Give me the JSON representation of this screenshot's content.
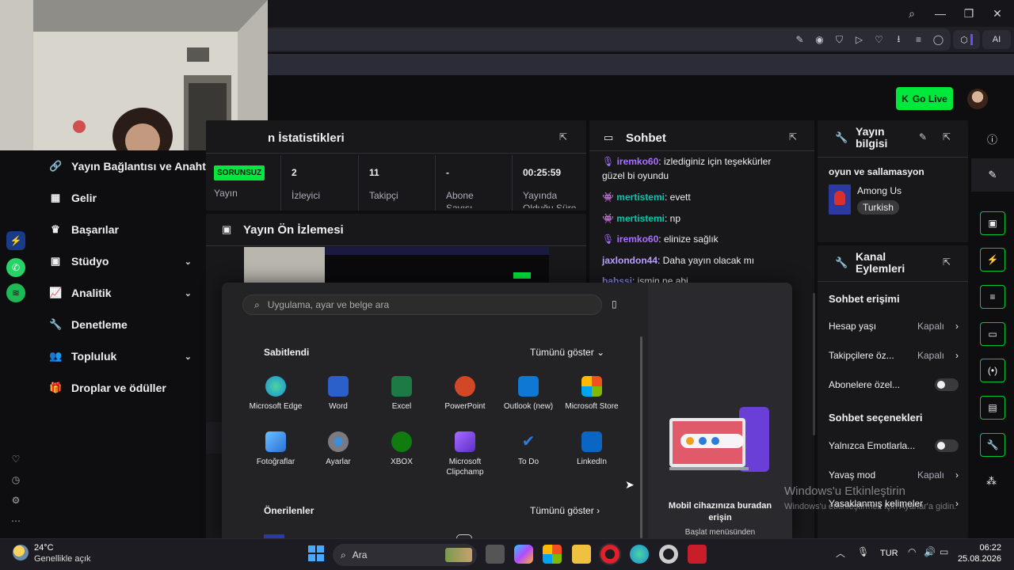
{
  "window": {
    "min": "—",
    "max": "❐",
    "close": "✕",
    "search": "⌕"
  },
  "toolbar": {
    "icons": [
      "✎",
      "◉",
      "⛉",
      "▷",
      "♡",
      "⭳",
      "≡",
      "◯"
    ],
    "ext": "⬡",
    "ai": "AI"
  },
  "header": {
    "go_live": "Go Live"
  },
  "sidebar": {
    "items": [
      {
        "label": "Yayın Bağlantısı ve Anahtarı",
        "icon": "link-icon",
        "glyph": "🔗"
      },
      {
        "label": "Gelir",
        "icon": "revenue-icon",
        "glyph": "▦"
      },
      {
        "label": "Başarılar",
        "icon": "trophy-icon",
        "glyph": "♛"
      },
      {
        "label": "Stüdyo",
        "icon": "studio-icon",
        "glyph": "▣",
        "chevron": "⌄"
      },
      {
        "label": "Analitik",
        "icon": "analytics-icon",
        "glyph": "📈",
        "chevron": "⌄"
      },
      {
        "label": "Denetleme",
        "icon": "wrench-icon",
        "glyph": "🔧"
      },
      {
        "label": "Topluluk",
        "icon": "community-icon",
        "glyph": "👥",
        "chevron": "⌄"
      },
      {
        "label": "Droplar ve ödüller",
        "icon": "drops-icon",
        "glyph": "🎁"
      }
    ]
  },
  "stats": {
    "title": "n İstatistikleri",
    "status_badge": "SORUNSUZ",
    "status_label": "Yayın",
    "items": [
      {
        "value": "2",
        "label": "İzleyici"
      },
      {
        "value": "11",
        "label": "Takipçi"
      },
      {
        "value": "-",
        "label": "Abone Sayısı"
      },
      {
        "value": "00:25:59",
        "label": "Yayında Olduğu Süre"
      }
    ]
  },
  "preview": {
    "title": "Yayın Ön İzlemesi"
  },
  "chat": {
    "title": "Sohbet",
    "messages": [
      {
        "user": "iremko60",
        "text": ": izlediginiz için teşekkürler güzel bi oyundu",
        "color": "#a970ff"
      },
      {
        "user": "mertistemi",
        "text": ": evett",
        "color": "#00c8af"
      },
      {
        "user": "mertistemi",
        "text": ": np",
        "color": "#00c8af"
      },
      {
        "user": "iremko60",
        "text": ": elinize sağlık",
        "color": "#a970ff"
      },
      {
        "user": "jaxlondon44",
        "text": ": Daha yayın olacak mı",
        "color": "#b8a0ff"
      },
      {
        "user": "babssi",
        "text": ": ismin ne abi",
        "color": "#8a8aff"
      }
    ]
  },
  "stream_info": {
    "title": "Yayın bilgisi",
    "stream_title": "oyun ve sallamasyon",
    "game": "Among Us",
    "tag": "Turkish"
  },
  "channel_actions": {
    "title": "Kanal Eylemleri",
    "chat_access": "Sohbet erişimi",
    "account_age": {
      "label": "Hesap yaşı",
      "value": "Kapalı"
    },
    "followers": {
      "label": "Takipçilere öz...",
      "value": "Kapalı"
    },
    "subscribers": {
      "label": "Abonelere özel..."
    },
    "chat_options": "Sohbet seçenekleri",
    "emotes": {
      "label": "Yalnızca Emotlarla..."
    },
    "slow": {
      "label": "Yavaş mod",
      "value": "Kapalı"
    },
    "banned": {
      "label": "Yasaklanmış kelimeler"
    }
  },
  "start_menu": {
    "search_placeholder": "Uygulama, ayar ve belge ara",
    "pinned": "Sabitlendi",
    "show_all": "Tümünü göster",
    "chev": "⌄",
    "apps": [
      {
        "name": "Microsoft Edge",
        "color": "#1a8fd8"
      },
      {
        "name": "Word",
        "color": "#2b5fc9"
      },
      {
        "name": "Excel",
        "color": "#1e7a45"
      },
      {
        "name": "PowerPoint",
        "color": "#d24726"
      },
      {
        "name": "Outlook (new)",
        "color": "#0f78d4"
      },
      {
        "name": "Microsoft Store",
        "color": "#e8e8e8"
      },
      {
        "name": "Fotoğraflar",
        "color": "#3a8fd8"
      },
      {
        "name": "Ayarlar",
        "color": "#7a7a80"
      },
      {
        "name": "XBOX",
        "color": "#107c10"
      },
      {
        "name": "Microsoft Clipchamp",
        "color": "#7b3fd8"
      },
      {
        "name": "To Do",
        "color": "#2e7bd8"
      },
      {
        "name": "LinkedIn",
        "color": "#0a66c2"
      }
    ],
    "recommended": "Önerilenler",
    "rec_show_all": "Tümünü göster",
    "rec_arrow": "›",
    "phone_title": "Mobil cihazınıza buradan erişin",
    "phone_sub": "Başlat menüsünden"
  },
  "watermark": {
    "line1": "Windows'u Etkinleştirin",
    "line2": "Windows'u etkinleştirmek için Ayarlar'a gidin."
  },
  "taskbar": {
    "temp": "24°C",
    "weather": "Genellikle açık",
    "search": "Ara",
    "lang": "TUR",
    "time": "06:22",
    "date": "25.08.2026"
  }
}
